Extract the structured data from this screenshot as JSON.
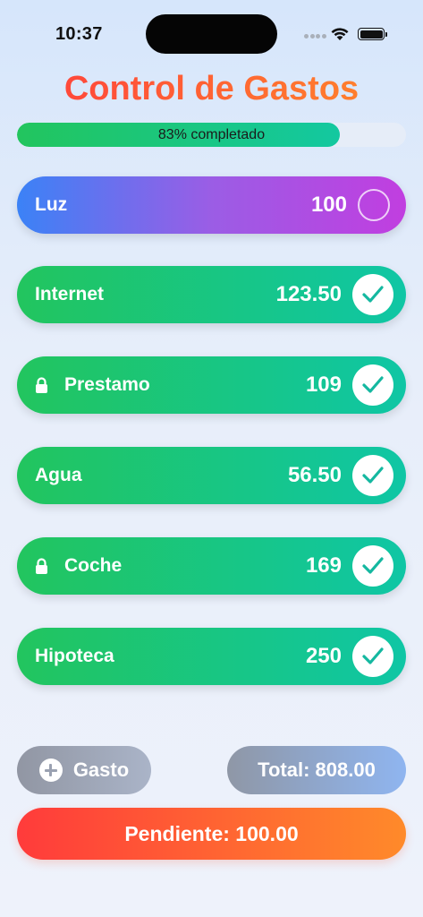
{
  "status_bar": {
    "time": "10:37"
  },
  "title": "Control de Gastos",
  "progress": {
    "percent": 83,
    "label": "83% completado",
    "fill_color": "#22c55e"
  },
  "expenses": [
    {
      "name": "Luz",
      "amount": "100",
      "paid": false,
      "locked": false
    },
    {
      "name": "Internet",
      "amount": "123.50",
      "paid": true,
      "locked": false
    },
    {
      "name": "Prestamo",
      "amount": "109",
      "paid": true,
      "locked": true
    },
    {
      "name": "Agua",
      "amount": "56.50",
      "paid": true,
      "locked": false
    },
    {
      "name": "Coche",
      "amount": "169",
      "paid": true,
      "locked": true
    },
    {
      "name": "Hipoteca",
      "amount": "250",
      "paid": true,
      "locked": false
    }
  ],
  "buttons": {
    "add_label": "Gasto",
    "total_label": "Total: 808.00",
    "pending_label": "Pendiente: 100.00"
  },
  "icons": {
    "add": "plus-circle-icon",
    "paid": "check-icon",
    "unpaid": "empty-circle-icon",
    "locked": "lock-icon"
  },
  "colors": {
    "paid_start": "#22c55e",
    "paid_end": "#0fc6a5",
    "check_color": "#14b8a0",
    "title_start": "#ff3d3d",
    "title_end": "#ff8a2a"
  }
}
